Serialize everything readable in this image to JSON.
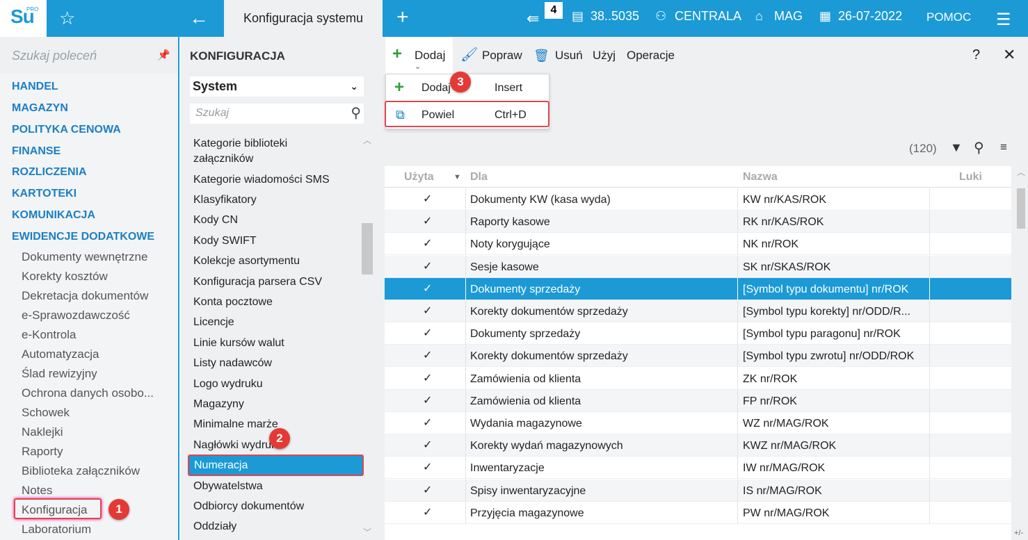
{
  "topbar": {
    "logo_text": "Su",
    "logo_pro": "PRO",
    "active_tab": "Konfiguracja systemu",
    "notification_count": "4",
    "user": "38..5035",
    "branch": "CENTRALA",
    "warehouse": "MAG",
    "date": "26-07-2022",
    "help": "POMOC"
  },
  "left": {
    "search_placeholder": "Szukaj poleceń",
    "sections": [
      "HANDEL",
      "MAGAZYN",
      "POLITYKA CENOWA",
      "FINANSE",
      "ROZLICZENIA",
      "KARTOTEKI",
      "KOMUNIKACJA",
      "EWIDENCJE DODATKOWE"
    ],
    "subitems": [
      "Dokumenty wewnętrzne",
      "Korekty kosztów",
      "Dekretacja dokumentów",
      "e-Sprawozdawczość",
      "e-Kontrola",
      "Automatyzacja",
      "Ślad rewizyjny",
      "Ochrona danych osobo...",
      "Schowek",
      "Naklejki",
      "Raporty",
      "Biblioteka załączników",
      "Notes",
      "Konfiguracja",
      "Laboratorium"
    ]
  },
  "middle": {
    "title": "KONFIGURACJA",
    "select_value": "System",
    "search_placeholder": "Szukaj",
    "items": [
      "Kategorie biblioteki",
      "załączników",
      "Kategorie wiadomości SMS",
      "Klasyfikatory",
      "Kody CN",
      "Kody SWIFT",
      "Kolekcje asortymentu",
      "Konfiguracja parsera CSV",
      "Konta pocztowe",
      "Licencje",
      "Linie kursów walut",
      "Listy nadawców",
      "Logo wydruku",
      "Magazyny",
      "Minimalne marże",
      "Nagłówki wydruku",
      "Numeracja",
      "Obywatelstwa",
      "Odbiorcy dokumentów",
      "Oddziały"
    ]
  },
  "toolbar": {
    "dodaj": "Dodaj",
    "popraw": "Popraw",
    "usun": "Usuń",
    "uzyj": "Użyj",
    "operacje": "Operacje",
    "help": "?",
    "close": "✕"
  },
  "dropdown": {
    "items": [
      {
        "label": "Dodaj",
        "shortcut": "Insert"
      },
      {
        "label": "Powiel",
        "shortcut": "Ctrl+D"
      }
    ]
  },
  "callouts": [
    "1",
    "2",
    "3"
  ],
  "grid": {
    "count": "(120)",
    "columns": [
      "Użyta",
      "Dla",
      "Nazwa",
      "Luki"
    ],
    "rows": [
      {
        "check": "✓",
        "dla": "Dokumenty KW (kasa wyda)",
        "nazwa": "KW nr/KAS/ROK"
      },
      {
        "check": "✓",
        "dla": "Raporty kasowe",
        "nazwa": "RK nr/KAS/ROK"
      },
      {
        "check": "✓",
        "dla": "Noty korygujące",
        "nazwa": "NK nr/ROK"
      },
      {
        "check": "✓",
        "dla": "Sesje kasowe",
        "nazwa": "SK nr/SKAS/ROK"
      },
      {
        "check": "✓",
        "dla": "Dokumenty sprzedaży",
        "nazwa": "[Symbol typu dokumentu] nr/ROK"
      },
      {
        "check": "✓",
        "dla": "Korekty dokumentów sprzedaży",
        "nazwa": "[Symbol typu korekty] nr/ODD/R..."
      },
      {
        "check": "✓",
        "dla": "Dokumenty sprzedaży",
        "nazwa": "[Symbol typu paragonu] nr/ROK"
      },
      {
        "check": "✓",
        "dla": "Korekty dokumentów sprzedaży",
        "nazwa": "[Symbol typu zwrotu] nr/ODD/ROK"
      },
      {
        "check": "✓",
        "dla": "Zamówienia od klienta",
        "nazwa": "ZK nr/ROK"
      },
      {
        "check": "✓",
        "dla": "Zamówienia od klienta",
        "nazwa": "FP nr/ROK"
      },
      {
        "check": "✓",
        "dla": "Wydania magazynowe",
        "nazwa": "WZ nr/MAG/ROK"
      },
      {
        "check": "✓",
        "dla": "Korekty wydań magazynowych",
        "nazwa": "KWZ nr/MAG/ROK"
      },
      {
        "check": "✓",
        "dla": "Inwentaryzacje",
        "nazwa": "IW nr/MAG/ROK"
      },
      {
        "check": "✓",
        "dla": "Spisy inwentaryzacyjne",
        "nazwa": "IS nr/MAG/ROK"
      },
      {
        "check": "✓",
        "dla": "Przyjęcia magazynowe",
        "nazwa": "PW nr/MAG/ROK"
      }
    ],
    "selected_row": 4,
    "footer": "+/-"
  }
}
